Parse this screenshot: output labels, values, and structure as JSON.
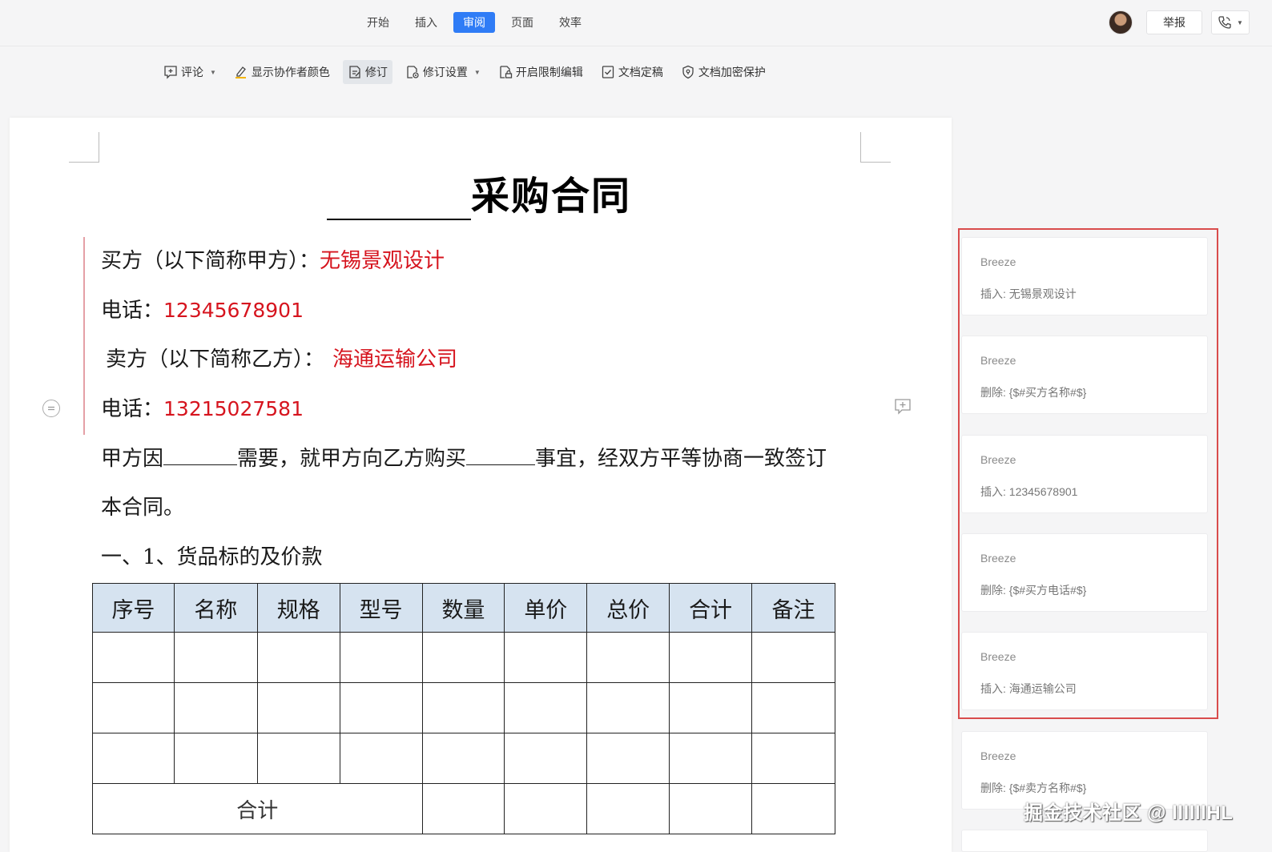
{
  "header": {
    "tabs": [
      "开始",
      "插入",
      "审阅",
      "页面",
      "效率"
    ],
    "active_tab": "审阅",
    "report_label": "举报",
    "accent_color": "#2f7cf6"
  },
  "toolbar": {
    "comment_label": "评论",
    "show_author_color_label": "显示协作者颜色",
    "revise_label": "修订",
    "revise_settings_label": "修订设置",
    "restrict_edit_label": "开启限制编辑",
    "finalize_label": "文档定稿",
    "encrypt_label": "文档加密保护"
  },
  "document": {
    "title": "采购合同",
    "buyer_label": "买方（以下简称甲方）：",
    "buyer_value": "无锡景观设计",
    "phone_label_1": "电话：",
    "phone_value_1": "12345678901",
    "seller_label": "卖方（以下简称乙方）：",
    "seller_value": "海通运输公司",
    "phone_label_2": "电话：",
    "phone_value_2": "13215027581",
    "para_part1": "甲方因",
    "para_part2": "需要，就甲方向乙方购买",
    "para_part3": "事宜，经双方平等协商一致签订",
    "para_line2": "本合同。",
    "section_heading": "一、1、货品标的及价款",
    "table_headers": [
      "序号",
      "名称",
      "规格",
      "型号",
      "数量",
      "单价",
      "总价",
      "合计",
      "备注"
    ],
    "table_total_label": "合计",
    "revision_color": "#d6141e"
  },
  "revisions": [
    {
      "author": "Breeze",
      "desc": "插入: 无锡景观设计"
    },
    {
      "author": "Breeze",
      "desc": "删除: {$#买方名称#$}"
    },
    {
      "author": "Breeze",
      "desc": "插入: 12345678901"
    },
    {
      "author": "Breeze",
      "desc": "删除: {$#买方电话#$}"
    },
    {
      "author": "Breeze",
      "desc": "插入: 海通运输公司"
    },
    {
      "author": "Breeze",
      "desc": "删除: {$#卖方名称#$}"
    }
  ],
  "watermark": "掘金技术社区 @ llllllHL",
  "highlight_color": "#d94c4c"
}
